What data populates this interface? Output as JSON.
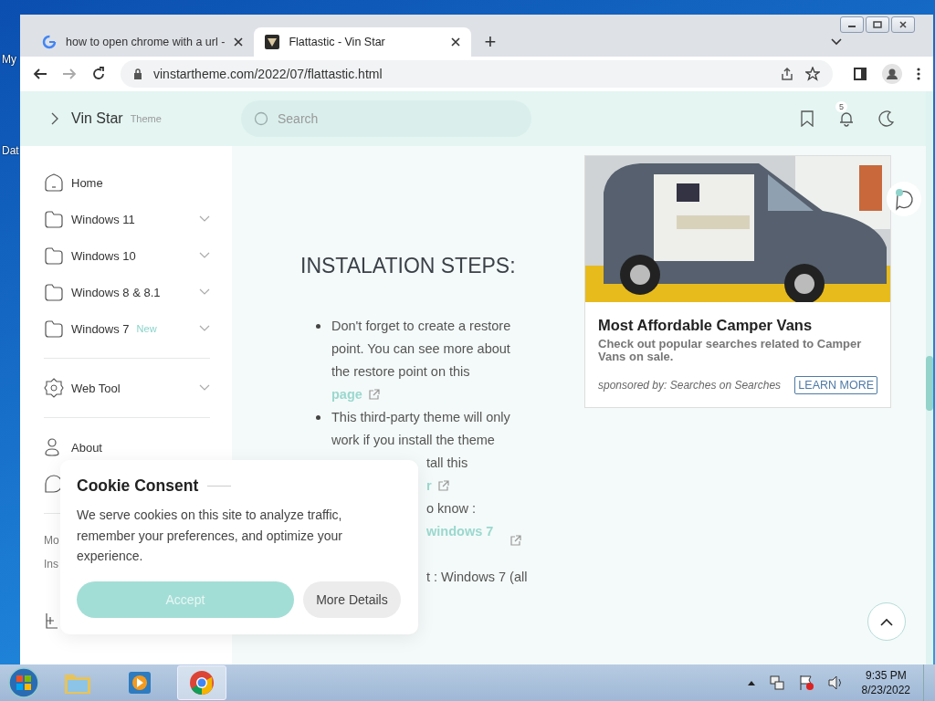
{
  "desktop": {
    "icon_labels": [
      "My",
      "Dat"
    ]
  },
  "browser": {
    "tabs": [
      {
        "title": "how to open chrome with a url -",
        "kind": "google",
        "selected": false
      },
      {
        "title": "Flattastic - Vin Star",
        "kind": "site",
        "selected": true
      }
    ],
    "new_tab": "+",
    "address": "vinstartheme.com/2022/07/flattastic.html"
  },
  "site": {
    "brand": "Vin Star",
    "brand_sub": "Theme",
    "search": {
      "placeholder": "Search"
    },
    "notification_count": "5"
  },
  "sidebar": {
    "groups": [
      [
        {
          "label": "Home",
          "kind": "home",
          "expandable": false
        },
        {
          "label": "Windows 11",
          "kind": "folder",
          "expandable": true
        },
        {
          "label": "Windows 10",
          "kind": "folder",
          "expandable": true
        },
        {
          "label": "Windows 8 & 8.1",
          "kind": "folder",
          "expandable": true
        },
        {
          "label": "Windows 7",
          "badge": "New",
          "kind": "folder",
          "expandable": true
        }
      ],
      [
        {
          "label": "Web Tool",
          "kind": "gear",
          "expandable": true
        }
      ],
      [
        {
          "label": "About",
          "kind": "person",
          "expandable": false
        }
      ]
    ],
    "fragments": [
      "Mo",
      "Ins"
    ]
  },
  "article": {
    "heading": "INSTALATION STEPS:",
    "items": [
      {
        "text": "Don't forget to create a restore point. You can see more about the restore point on this",
        "link": "page"
      },
      {
        "text": "This third-party theme will only work if you install the theme"
      }
    ],
    "covered_fragments": [
      {
        "text": "tall this"
      },
      {
        "text": "r",
        "link": true,
        "external": true
      },
      {
        "text": "o know :"
      },
      {
        "text": "windows 7",
        "link": true,
        "external": true
      },
      {
        "text": "t : Windows 7 (all"
      }
    ]
  },
  "ad": {
    "title": "Most Affordable Camper Vans",
    "text": "Check out popular searches related to Camper Vans on sale.",
    "sponsor": "sponsored by: Searches on Searches",
    "button": "LEARN MORE"
  },
  "cookie": {
    "title": "Cookie Consent",
    "text": "We serve cookies on this site to analyze traffic, remember your preferences, and optimize your experience.",
    "accept": "Accept",
    "details": "More Details"
  },
  "taskbar": {
    "apps": [
      {
        "kind": "folder",
        "selected": false
      },
      {
        "kind": "media",
        "selected": false
      },
      {
        "kind": "chrome",
        "selected": true
      }
    ],
    "time": "9:35 PM",
    "date": "8/23/2022"
  }
}
